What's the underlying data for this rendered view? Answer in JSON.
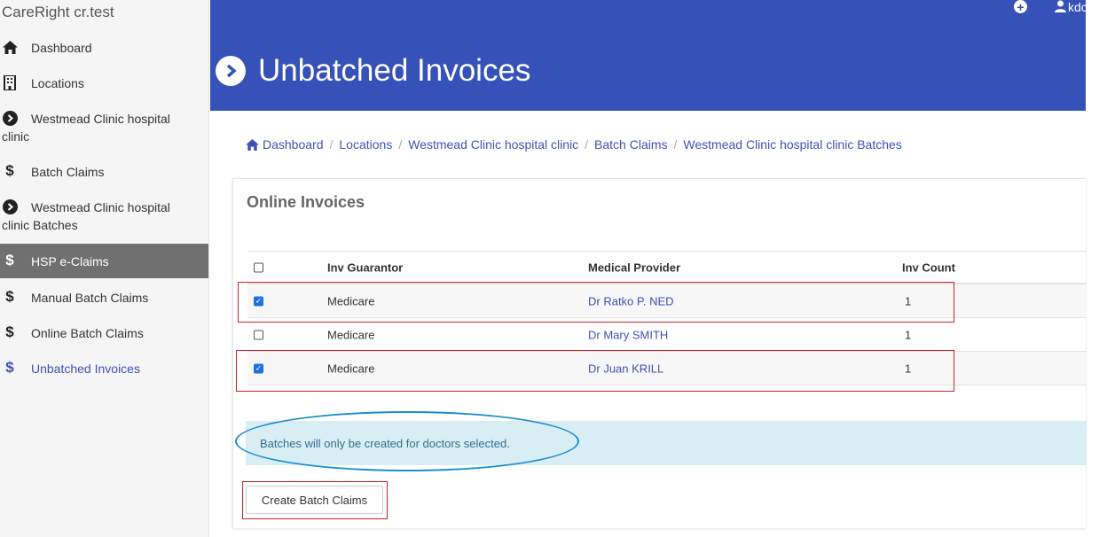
{
  "app": {
    "brand": "CareRight cr.test"
  },
  "sidebar": {
    "items": [
      {
        "label": "Dashboard",
        "icon": "home-icon"
      },
      {
        "label": "Locations",
        "icon": "building-icon"
      },
      {
        "label": "Westmead Clinic hospital clinic",
        "icon": "chevron-circle-right-icon"
      },
      {
        "label": "Batch Claims",
        "icon": "dollar-icon"
      },
      {
        "label": "Westmead Clinic hospital clinic Batches",
        "icon": "chevron-circle-right-icon"
      },
      {
        "label": "HSP e-Claims",
        "icon": "dollar-icon"
      },
      {
        "label": "Manual Batch Claims",
        "icon": "dollar-icon"
      },
      {
        "label": "Online Batch Claims",
        "icon": "dollar-icon"
      },
      {
        "label": "Unbatched Invoices",
        "icon": "dollar-icon"
      }
    ],
    "active_index": 5,
    "current_index": 8
  },
  "header": {
    "title": "Unbatched Invoices",
    "user": "kdc"
  },
  "breadcrumb": [
    "Dashboard",
    "Locations",
    "Westmead Clinic hospital clinic",
    "Batch Claims",
    "Westmead Clinic hospital clinic Batches"
  ],
  "panel": {
    "title": "Online Invoices",
    "columns": [
      "Inv Guarantor",
      "Medical Provider",
      "Inv Count"
    ],
    "rows": [
      {
        "checked": true,
        "guarantor": "Medicare",
        "provider": "Dr Ratko P. NED",
        "count": "1"
      },
      {
        "checked": false,
        "guarantor": "Medicare",
        "provider": "Dr Mary SMITH",
        "count": "1"
      },
      {
        "checked": true,
        "guarantor": "Medicare",
        "provider": "Dr Juan KRILL",
        "count": "1"
      }
    ],
    "notice": "Batches will only be created for doctors selected.",
    "button_label": "Create Batch Claims"
  },
  "colors": {
    "header_bg": "#3651b8",
    "link": "#3f51b5",
    "annotation_red": "#c9242b",
    "annotation_blue": "#1a8fd0",
    "notice_bg": "#d9edf4"
  }
}
